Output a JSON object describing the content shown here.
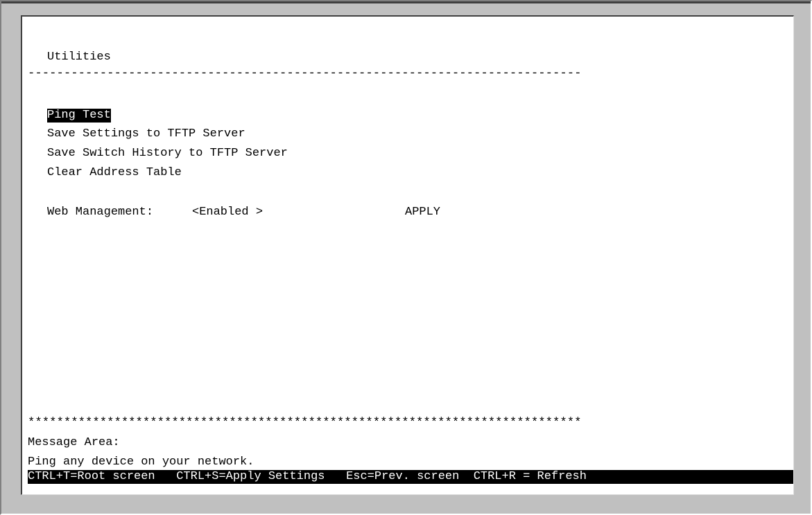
{
  "screen": {
    "title": "Utilities",
    "separator_dashes": "-----------------------------------------------------------------------------",
    "menu": [
      {
        "label": "Ping Test",
        "selected": true
      },
      {
        "label": "Save Settings to TFTP Server",
        "selected": false
      },
      {
        "label": "Save Switch History to TFTP Server",
        "selected": false
      },
      {
        "label": "Clear Address Table",
        "selected": false
      }
    ],
    "web_management": {
      "label": "Web Management:",
      "value": "<Enabled >",
      "apply_label": "APPLY"
    },
    "separator_stars": "*****************************************************************************",
    "message_area_label": "Message Area:",
    "message_text": "Ping any device on your network.",
    "footer": "CTRL+T=Root screen   CTRL+S=Apply Settings   Esc=Prev. screen  CTRL+R = Refresh"
  }
}
